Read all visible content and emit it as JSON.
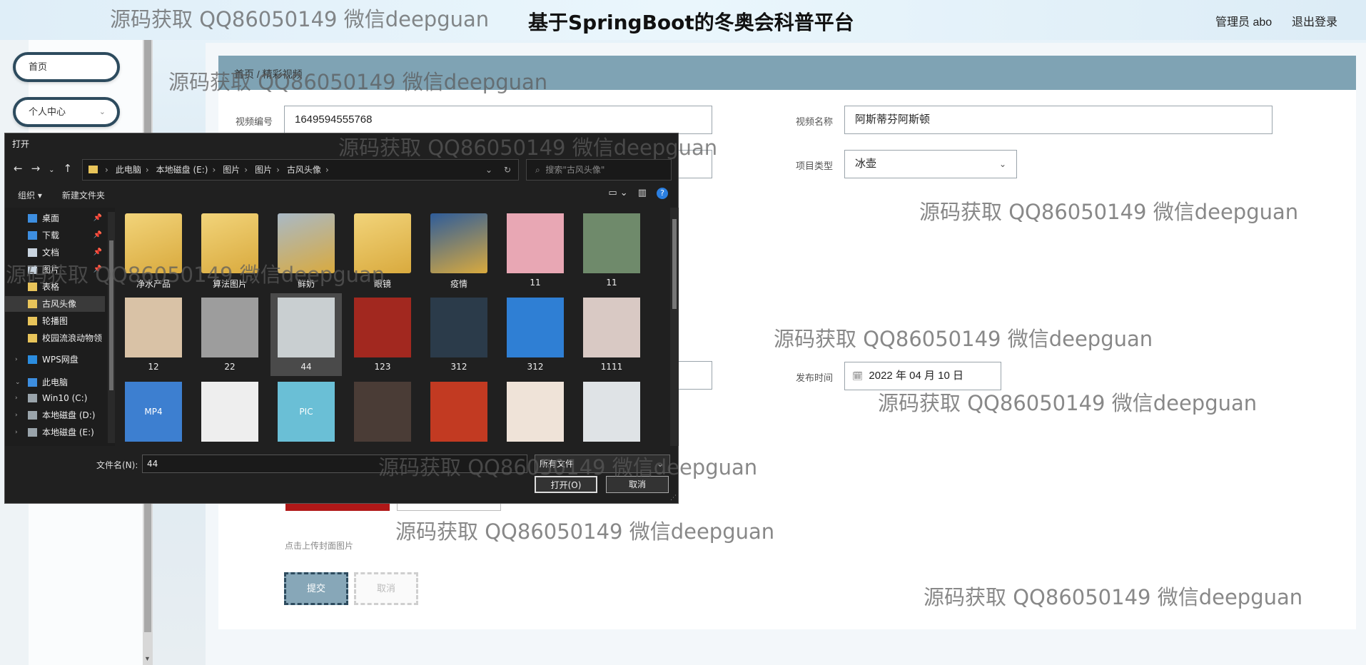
{
  "header": {
    "title": "基于SpringBoot的冬奥会科普平台",
    "admin": "管理员 abo",
    "logout": "退出登录"
  },
  "sidebar": {
    "home": "首页",
    "personal": "个人中心"
  },
  "breadcrumb": {
    "home": "首页",
    "separator": "/",
    "current": "精彩视频"
  },
  "form": {
    "video_no_label": "视频编号",
    "video_no_value": "1649594555768",
    "video_name_label": "视频名称",
    "video_name_value": "阿斯蒂芬阿斯顿",
    "project_type_label": "项目类型",
    "project_type_value": "冰壶",
    "publish_time_label": "发布时间",
    "publish_time_value": "2022 年 04 月 10 日",
    "upload_hint": "点击上传封面图片",
    "submit": "提交",
    "cancel": "取消"
  },
  "watermark": "源码获取 QQ86050149 微信deepguan",
  "dialog": {
    "title": "打开",
    "path": [
      "此电脑",
      "本地磁盘 (E:)",
      "图片",
      "图片",
      "古风头像"
    ],
    "search_placeholder": "搜索\"古风头像\"",
    "organize": "组织 ▾",
    "new_folder": "新建文件夹",
    "nav": [
      {
        "label": "桌面",
        "pinned": true,
        "color": "#3d8ee0"
      },
      {
        "label": "下载",
        "pinned": true,
        "color": "#3d8ee0"
      },
      {
        "label": "文档",
        "pinned": true,
        "color": "#c9d4df"
      },
      {
        "label": "图片",
        "pinned": true,
        "color": "#c9d4df"
      },
      {
        "label": "表格",
        "pinned": false,
        "color": "#e8c45a"
      },
      {
        "label": "古风头像",
        "pinned": false,
        "color": "#e8c45a"
      },
      {
        "label": "轮播图",
        "pinned": false,
        "color": "#e8c45a"
      },
      {
        "label": "校园流浪动物领",
        "pinned": false,
        "color": "#e8c45a"
      },
      {
        "label": "WPS网盘",
        "pinned": false,
        "color": "#2b8de0"
      },
      {
        "label": "此电脑",
        "pinned": false,
        "color": "#3d8ee0"
      },
      {
        "label": "Win10 (C:)",
        "pinned": false,
        "color": "#9aa4ab"
      },
      {
        "label": "本地磁盘 (D:)",
        "pinned": false,
        "color": "#9aa4ab"
      },
      {
        "label": "本地磁盘 (E:)",
        "pinned": false,
        "color": "#9aa4ab"
      }
    ],
    "files": [
      {
        "name": "净水产品",
        "kind": "folder",
        "color": "#f2d47a"
      },
      {
        "name": "算法图片",
        "kind": "folder",
        "color": "#f2d47a"
      },
      {
        "name": "鲜奶",
        "kind": "folder",
        "color": "#a9b9c6"
      },
      {
        "name": "眼镜",
        "kind": "folder",
        "color": "#f2d47a"
      },
      {
        "name": "疫情",
        "kind": "folder",
        "color": "#2e5c9a"
      },
      {
        "name": "11",
        "kind": "image",
        "color": "#e8a7b4"
      },
      {
        "name": "11",
        "kind": "image",
        "color": "#6f8a6b"
      },
      {
        "name": "12",
        "kind": "image",
        "color": "#d9c2a6"
      },
      {
        "name": "22",
        "kind": "image",
        "color": "#9d9d9d"
      },
      {
        "name": "44",
        "kind": "image",
        "color": "#c9cfd1"
      },
      {
        "name": "123",
        "kind": "image",
        "color": "#a2281f"
      },
      {
        "name": "312",
        "kind": "image",
        "color": "#2b3b4a"
      },
      {
        "name": "312",
        "kind": "image",
        "color": "#2f7fd4"
      },
      {
        "name": "1111",
        "kind": "image",
        "color": "#d9c9c4"
      },
      {
        "name": "",
        "kind": "mp4",
        "color": "#3d7fd0"
      },
      {
        "name": "",
        "kind": "doc",
        "color": "#eeeeee"
      },
      {
        "name": "",
        "kind": "pic",
        "color": "#6abfd6"
      },
      {
        "name": "",
        "kind": "image",
        "color": "#4a3c36"
      },
      {
        "name": "",
        "kind": "image",
        "color": "#c23a22"
      },
      {
        "name": "",
        "kind": "image",
        "color": "#efe3d8"
      },
      {
        "name": "",
        "kind": "image",
        "color": "#dfe3e6"
      }
    ],
    "selected_file": "44",
    "filename_label": "文件名(N):",
    "filename_value": "44",
    "filetype": "所有文件",
    "open": "打开(O)",
    "cancel": "取消"
  }
}
